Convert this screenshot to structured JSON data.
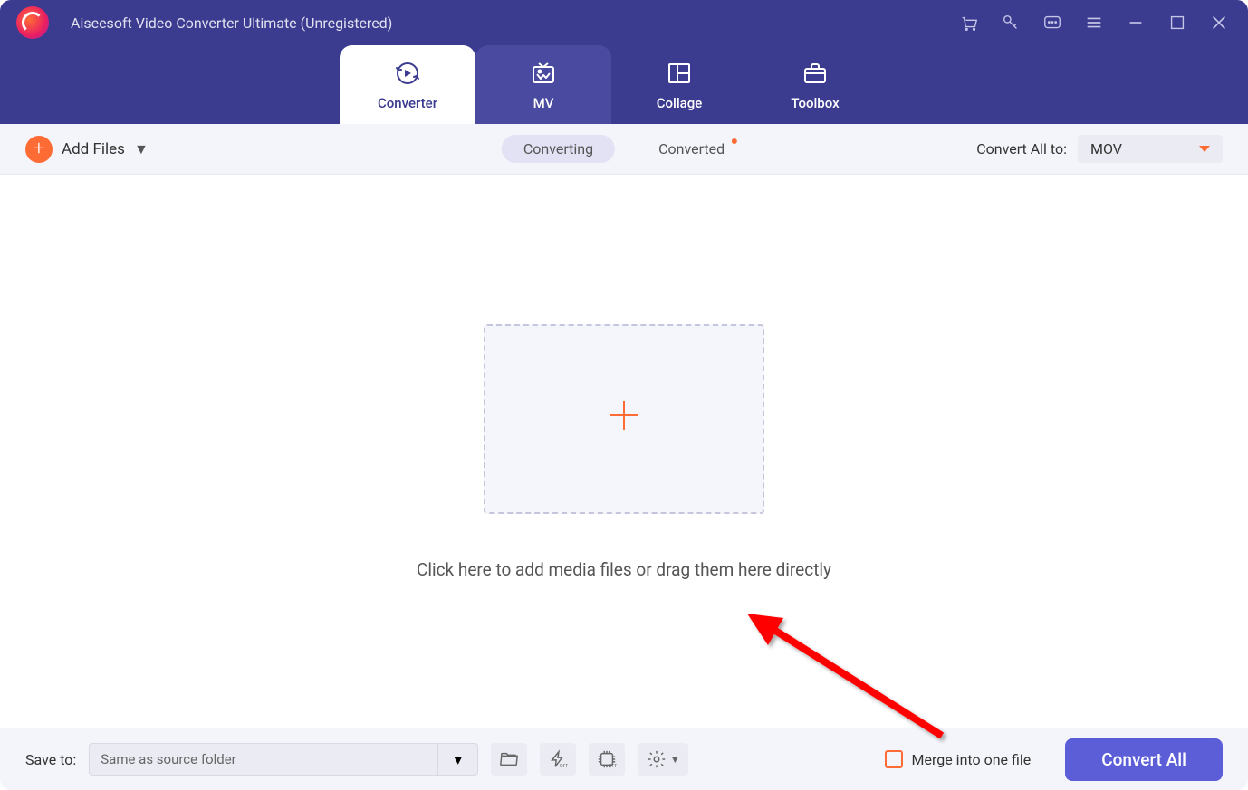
{
  "app": {
    "title": "Aiseesoft Video Converter Ultimate (Unregistered)"
  },
  "tabs": {
    "converter": "Converter",
    "mv": "MV",
    "collage": "Collage",
    "toolbox": "Toolbox"
  },
  "toolbar": {
    "add_files_label": "Add Files",
    "converting_label": "Converting",
    "converted_label": "Converted",
    "convert_all_to_label": "Convert All to:",
    "format_value": "MOV"
  },
  "main": {
    "hint": "Click here to add media files or drag them here directly"
  },
  "bottom": {
    "save_to_label": "Save to:",
    "save_to_value": "Same as source folder",
    "merge_label": "Merge into one file",
    "convert_all_label": "Convert All"
  }
}
